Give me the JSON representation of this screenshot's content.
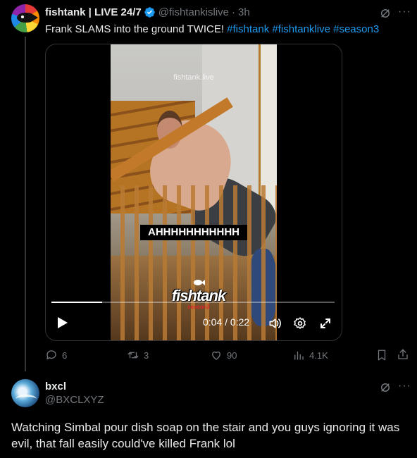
{
  "tweet": {
    "display_name": "fishtank | LIVE 24/7",
    "handle": "@fishtankislive",
    "separator": "·",
    "time": "3h",
    "text_plain": "Frank SLAMS into the ground TWICE!",
    "hashtags": [
      "#fishtank",
      "#fishtanklive",
      "#season3"
    ],
    "more": "···"
  },
  "media": {
    "watermark": "fishtank.live",
    "caption": "AHHHHHHHHHHH",
    "logo_text": "fishtank",
    "logo_sub": "season3",
    "time_current": "0:04",
    "time_sep": " / ",
    "time_total": "0:22",
    "progress": 0.18
  },
  "actions": {
    "replies": "6",
    "reposts": "3",
    "likes": "90",
    "views": "4.1K"
  },
  "reply": {
    "display_name": "bxcl",
    "handle": "@BXCLXYZ",
    "more": "···",
    "text": "Watching Simbal pour dish soap on the stair and you guys ignoring it was evil, that fall easily could've killed Frank lol"
  },
  "colors": {
    "background": "#000000",
    "text": "#e7e9ea",
    "muted": "#71767b",
    "accent": "#1d9bf0"
  }
}
